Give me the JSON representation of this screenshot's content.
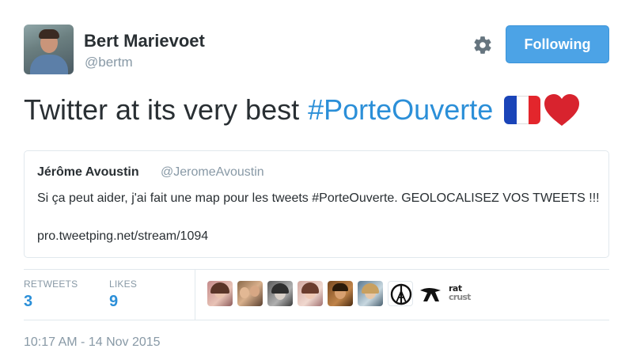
{
  "author": {
    "name": "Bert Marievoet",
    "handle": "@bertm"
  },
  "follow_button": {
    "label": "Following"
  },
  "tweet": {
    "text": "Twitter at its very best",
    "hashtag": "#PorteOuverte",
    "emoji": [
      "french-flag",
      "red-heart"
    ]
  },
  "quoted_tweet": {
    "name": "Jérôme Avoustin",
    "handle": "@JeromeAvoustin",
    "text": "Si ça peut aider, j'ai fait une map pour les tweets #PorteOuverte. GEOLOCALISEZ VOS TWEETS !!!",
    "link": "pro.tweetping.net/stream/1094"
  },
  "stats": {
    "retweets_label": "RETWEETS",
    "retweets_value": "3",
    "likes_label": "LIKES",
    "likes_value": "9"
  },
  "liker_avatars": [
    {
      "icon": "woman-avatar"
    },
    {
      "icon": "couple-avatar"
    },
    {
      "icon": "woman-avatar"
    },
    {
      "icon": "woman-avatar"
    },
    {
      "icon": "man-avatar"
    },
    {
      "icon": "woman-avatar"
    },
    {
      "icon": "peace-for-paris-icon"
    },
    {
      "icon": "logo-avatar"
    },
    {
      "icon": "text-logo-avatar",
      "text": "rat crust"
    }
  ],
  "timestamp": "10:17 AM - 14 Nov 2015",
  "colors": {
    "link_blue": "#2b8fd8",
    "button_blue": "#4ca3e6",
    "muted_text": "#8899a6",
    "body_text": "#292f33",
    "border": "#e1e8ed"
  }
}
